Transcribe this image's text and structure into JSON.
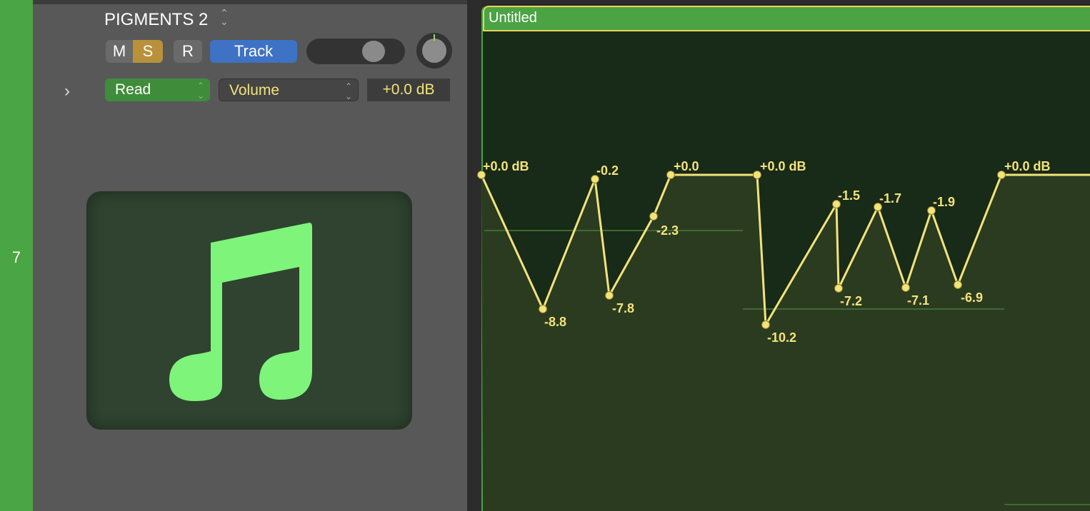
{
  "track": {
    "number": "7",
    "name": "PIGMENTS 2",
    "name_arrows": "⌃⌄",
    "buttons": {
      "mute": "M",
      "solo": "S",
      "record": "R",
      "track": "Track"
    },
    "automation_mode": "Read",
    "parameter": "Volume",
    "value": "+0.0 dB",
    "expand": "›",
    "icon": "music-note-icon"
  },
  "region": {
    "title": "Untitled"
  },
  "automation": {
    "unit": "dB",
    "points": [
      {
        "value": 0.0,
        "label": "+0.0 dB"
      },
      {
        "value": -8.8,
        "label": "-8.8"
      },
      {
        "value": -0.2,
        "label": "-0.2"
      },
      {
        "value": -7.8,
        "label": "-7.8"
      },
      {
        "value": -2.3,
        "label": "-2.3"
      },
      {
        "value": 0.0,
        "label": "+0.0"
      },
      {
        "value": 0.0,
        "label": "+0.0 dB"
      },
      {
        "value": -10.2,
        "label": "-10.2"
      },
      {
        "value": -1.5,
        "label": "-1.5"
      },
      {
        "value": -7.2,
        "label": "-7.2"
      },
      {
        "value": -1.7,
        "label": "-1.7"
      },
      {
        "value": -7.1,
        "label": "-7.1"
      },
      {
        "value": -1.9,
        "label": "-1.9"
      },
      {
        "value": -6.9,
        "label": "-6.9"
      },
      {
        "value": 0.0,
        "label": "+0.0 dB"
      }
    ]
  },
  "colors": {
    "track_green": "#4aa544",
    "solo": "#b9913b",
    "track_button": "#3e72c4",
    "automation": "#f3e37a",
    "note": "#7ef47a"
  }
}
